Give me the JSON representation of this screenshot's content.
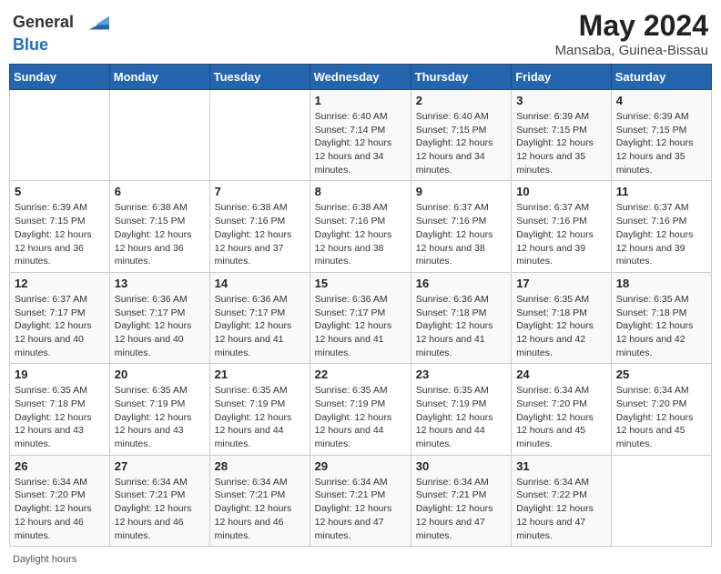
{
  "header": {
    "logo_line1": "General",
    "logo_line2": "Blue",
    "month_year": "May 2024",
    "location": "Mansaba, Guinea-Bissau"
  },
  "weekdays": [
    "Sunday",
    "Monday",
    "Tuesday",
    "Wednesday",
    "Thursday",
    "Friday",
    "Saturday"
  ],
  "weeks": [
    [
      {
        "day": "",
        "info": ""
      },
      {
        "day": "",
        "info": ""
      },
      {
        "day": "",
        "info": ""
      },
      {
        "day": "1",
        "sunrise": "6:40 AM",
        "sunset": "7:14 PM",
        "daylight": "12 hours and 34 minutes."
      },
      {
        "day": "2",
        "sunrise": "6:40 AM",
        "sunset": "7:15 PM",
        "daylight": "12 hours and 34 minutes."
      },
      {
        "day": "3",
        "sunrise": "6:39 AM",
        "sunset": "7:15 PM",
        "daylight": "12 hours and 35 minutes."
      },
      {
        "day": "4",
        "sunrise": "6:39 AM",
        "sunset": "7:15 PM",
        "daylight": "12 hours and 35 minutes."
      }
    ],
    [
      {
        "day": "5",
        "sunrise": "6:39 AM",
        "sunset": "7:15 PM",
        "daylight": "12 hours and 36 minutes."
      },
      {
        "day": "6",
        "sunrise": "6:38 AM",
        "sunset": "7:15 PM",
        "daylight": "12 hours and 36 minutes."
      },
      {
        "day": "7",
        "sunrise": "6:38 AM",
        "sunset": "7:16 PM",
        "daylight": "12 hours and 37 minutes."
      },
      {
        "day": "8",
        "sunrise": "6:38 AM",
        "sunset": "7:16 PM",
        "daylight": "12 hours and 38 minutes."
      },
      {
        "day": "9",
        "sunrise": "6:37 AM",
        "sunset": "7:16 PM",
        "daylight": "12 hours and 38 minutes."
      },
      {
        "day": "10",
        "sunrise": "6:37 AM",
        "sunset": "7:16 PM",
        "daylight": "12 hours and 39 minutes."
      },
      {
        "day": "11",
        "sunrise": "6:37 AM",
        "sunset": "7:16 PM",
        "daylight": "12 hours and 39 minutes."
      }
    ],
    [
      {
        "day": "12",
        "sunrise": "6:37 AM",
        "sunset": "7:17 PM",
        "daylight": "12 hours and 40 minutes."
      },
      {
        "day": "13",
        "sunrise": "6:36 AM",
        "sunset": "7:17 PM",
        "daylight": "12 hours and 40 minutes."
      },
      {
        "day": "14",
        "sunrise": "6:36 AM",
        "sunset": "7:17 PM",
        "daylight": "12 hours and 41 minutes."
      },
      {
        "day": "15",
        "sunrise": "6:36 AM",
        "sunset": "7:17 PM",
        "daylight": "12 hours and 41 minutes."
      },
      {
        "day": "16",
        "sunrise": "6:36 AM",
        "sunset": "7:18 PM",
        "daylight": "12 hours and 41 minutes."
      },
      {
        "day": "17",
        "sunrise": "6:35 AM",
        "sunset": "7:18 PM",
        "daylight": "12 hours and 42 minutes."
      },
      {
        "day": "18",
        "sunrise": "6:35 AM",
        "sunset": "7:18 PM",
        "daylight": "12 hours and 42 minutes."
      }
    ],
    [
      {
        "day": "19",
        "sunrise": "6:35 AM",
        "sunset": "7:18 PM",
        "daylight": "12 hours and 43 minutes."
      },
      {
        "day": "20",
        "sunrise": "6:35 AM",
        "sunset": "7:19 PM",
        "daylight": "12 hours and 43 minutes."
      },
      {
        "day": "21",
        "sunrise": "6:35 AM",
        "sunset": "7:19 PM",
        "daylight": "12 hours and 44 minutes."
      },
      {
        "day": "22",
        "sunrise": "6:35 AM",
        "sunset": "7:19 PM",
        "daylight": "12 hours and 44 minutes."
      },
      {
        "day": "23",
        "sunrise": "6:35 AM",
        "sunset": "7:19 PM",
        "daylight": "12 hours and 44 minutes."
      },
      {
        "day": "24",
        "sunrise": "6:34 AM",
        "sunset": "7:20 PM",
        "daylight": "12 hours and 45 minutes."
      },
      {
        "day": "25",
        "sunrise": "6:34 AM",
        "sunset": "7:20 PM",
        "daylight": "12 hours and 45 minutes."
      }
    ],
    [
      {
        "day": "26",
        "sunrise": "6:34 AM",
        "sunset": "7:20 PM",
        "daylight": "12 hours and 46 minutes."
      },
      {
        "day": "27",
        "sunrise": "6:34 AM",
        "sunset": "7:21 PM",
        "daylight": "12 hours and 46 minutes."
      },
      {
        "day": "28",
        "sunrise": "6:34 AM",
        "sunset": "7:21 PM",
        "daylight": "12 hours and 46 minutes."
      },
      {
        "day": "29",
        "sunrise": "6:34 AM",
        "sunset": "7:21 PM",
        "daylight": "12 hours and 47 minutes."
      },
      {
        "day": "30",
        "sunrise": "6:34 AM",
        "sunset": "7:21 PM",
        "daylight": "12 hours and 47 minutes."
      },
      {
        "day": "31",
        "sunrise": "6:34 AM",
        "sunset": "7:22 PM",
        "daylight": "12 hours and 47 minutes."
      },
      {
        "day": "",
        "info": ""
      }
    ]
  ],
  "footer": {
    "daylight_label": "Daylight hours"
  }
}
